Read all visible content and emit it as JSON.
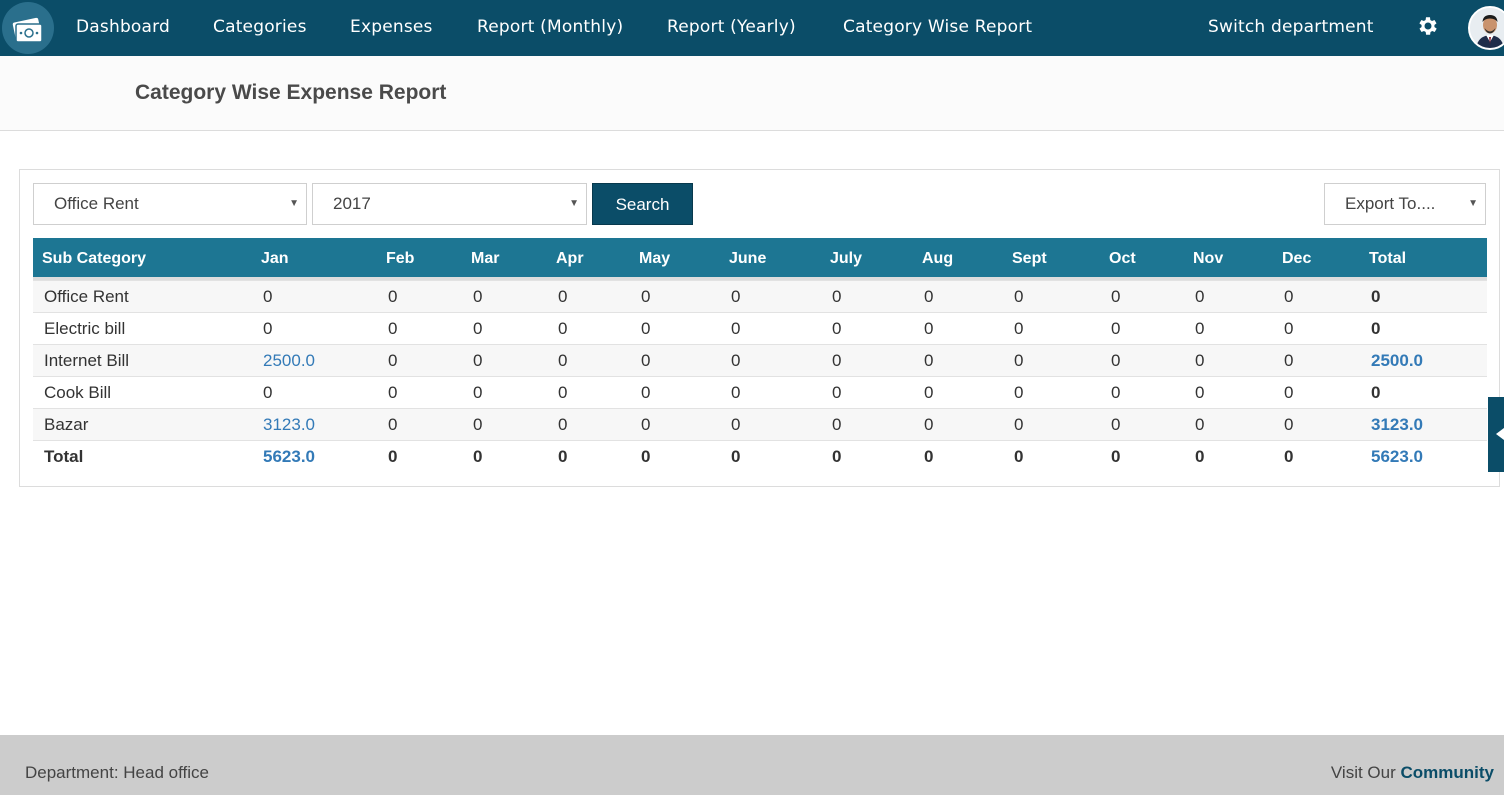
{
  "nav": {
    "items": [
      "Dashboard",
      "Categories",
      "Expenses",
      "Report (Monthly)",
      "Report (Yearly)",
      "Category Wise Report"
    ],
    "switch_department": "Switch department"
  },
  "page": {
    "title": "Category Wise Expense Report"
  },
  "filters": {
    "category": "Office Rent",
    "year": "2017",
    "search_label": "Search",
    "export_label": "Export To...."
  },
  "table": {
    "headers": [
      "Sub Category",
      "Jan",
      "Feb",
      "Mar",
      "Apr",
      "May",
      "June",
      "July",
      "Aug",
      "Sept",
      "Oct",
      "Nov",
      "Dec",
      "Total"
    ],
    "rows": [
      [
        "Office Rent",
        "0",
        "0",
        "0",
        "0",
        "0",
        "0",
        "0",
        "0",
        "0",
        "0",
        "0",
        "0",
        "0"
      ],
      [
        "Electric bill",
        "0",
        "0",
        "0",
        "0",
        "0",
        "0",
        "0",
        "0",
        "0",
        "0",
        "0",
        "0",
        "0"
      ],
      [
        "Internet Bill",
        "2500.0",
        "0",
        "0",
        "0",
        "0",
        "0",
        "0",
        "0",
        "0",
        "0",
        "0",
        "0",
        "2500.0"
      ],
      [
        "Cook Bill",
        "0",
        "0",
        "0",
        "0",
        "0",
        "0",
        "0",
        "0",
        "0",
        "0",
        "0",
        "0",
        "0"
      ],
      [
        "Bazar",
        "3123.0",
        "0",
        "0",
        "0",
        "0",
        "0",
        "0",
        "0",
        "0",
        "0",
        "0",
        "0",
        "3123.0"
      ]
    ],
    "total_row": [
      "Total",
      "5623.0",
      "0",
      "0",
      "0",
      "0",
      "0",
      "0",
      "0",
      "0",
      "0",
      "0",
      "0",
      "5623.0"
    ]
  },
  "footer": {
    "department": "Department: Head office",
    "visit_text": "Visit Our",
    "community_link": "Community"
  },
  "colors": {
    "nav_bg": "#0b4d68",
    "table_header": "#1d7693",
    "link": "#337ab7",
    "footer_bg": "#cccccc"
  }
}
